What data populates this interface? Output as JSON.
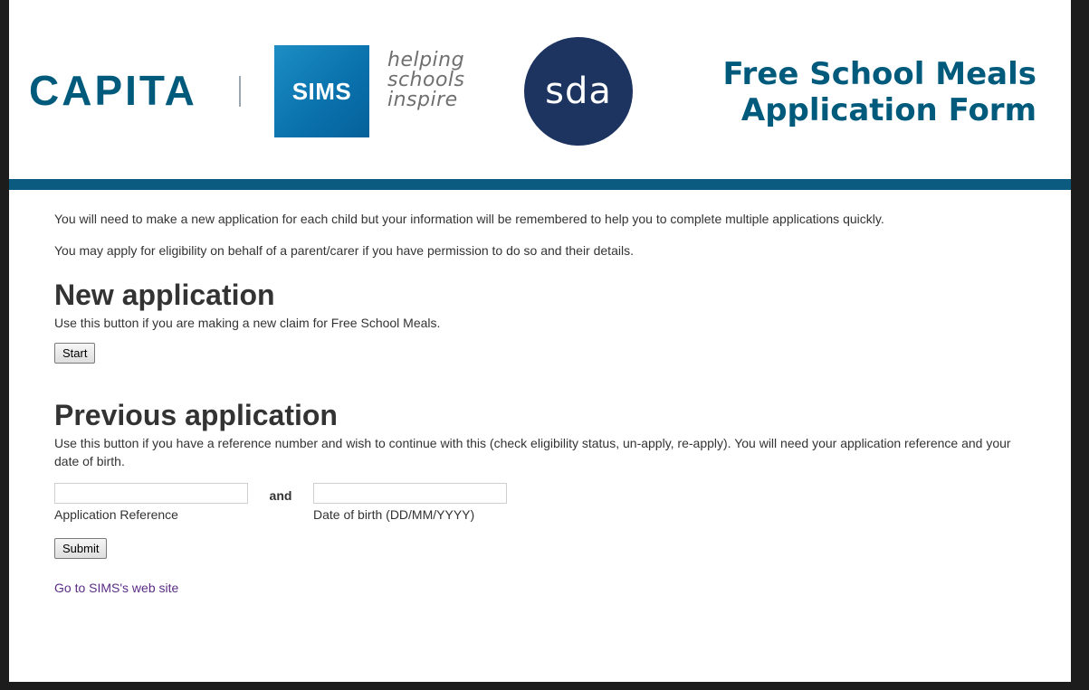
{
  "header": {
    "capita_logo_text": "CAPITA",
    "sims_logo_text": "SIMS",
    "tagline": [
      "helping",
      "schools",
      "inspire"
    ],
    "sda_logo_text": "sda",
    "title_line1": "Free School Meals",
    "title_line2": "Application Form"
  },
  "intro": {
    "paragraph1": "You will need to make a new application for each child but your information will be remembered to help you to complete multiple applications quickly.",
    "paragraph2": "You may apply for eligibility on behalf of a parent/carer if you have permission to do so and their details."
  },
  "new_application": {
    "heading": "New application",
    "description": "Use this button if you are making a new claim for Free School Meals.",
    "start_label": "Start"
  },
  "previous_application": {
    "heading": "Previous application",
    "description": "Use this button if you have a reference number and wish to continue with this (check eligibility status, un-apply, re-apply). You will need your application reference and your date of birth.",
    "reference_value": "",
    "reference_label": "Application Reference",
    "and_text": "and",
    "dob_value": "",
    "dob_label": "Date of birth (DD/MM/YYYY)",
    "submit_label": "Submit"
  },
  "footer": {
    "link_text": "Go to SIMS's web site"
  },
  "colors": {
    "brand_blue": "#005a7c",
    "header_bar": "#0b5a7f",
    "sda_navy": "#1d3461",
    "link_purple": "#5b2c86"
  }
}
